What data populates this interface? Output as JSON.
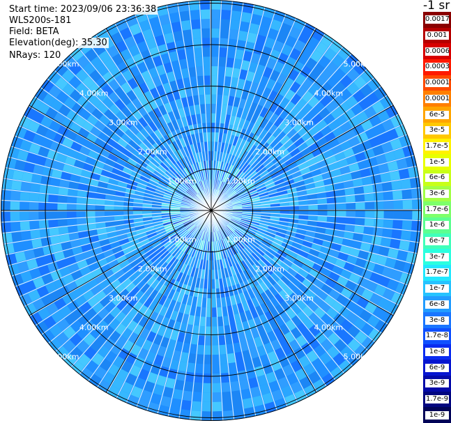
{
  "header": {
    "start_time": "Start time: 2023/09/06 23:36:38",
    "instrument": "WLS200s-181",
    "field": "Field: BETA",
    "elevation": "Elevation(deg): 35.30",
    "nrays": "NRays: 120"
  },
  "ppi": {
    "nrays": 120,
    "range_rings_km": [
      1,
      2,
      3,
      4,
      5
    ],
    "range_labels": [
      "1.00km",
      "2.00km",
      "3.00km",
      "4.00km",
      "5.00km"
    ],
    "spokes": 12,
    "dominant_color": "#1f8fff",
    "near_field_colors": [
      "#1a5fe0",
      "#3dc4ff",
      "#60e8f0"
    ]
  },
  "colorbar": {
    "title": "-1 sr",
    "levels": [
      {
        "label": "0.0017",
        "color": "#8a0000"
      },
      {
        "label": "0.001",
        "color": "#b50000"
      },
      {
        "label": "0.0006",
        "color": "#d80000"
      },
      {
        "label": "0.0003",
        "color": "#ff1a00"
      },
      {
        "label": "0.00017",
        "color": "#ff4a00"
      },
      {
        "label": "0.0001",
        "color": "#ff7f00"
      },
      {
        "label": "6e-5",
        "color": "#ffa500"
      },
      {
        "label": "3e-5",
        "color": "#ffc800"
      },
      {
        "label": "1.7e-5",
        "color": "#fff200"
      },
      {
        "label": "1e-5",
        "color": "#e8ff00"
      },
      {
        "label": "6e-6",
        "color": "#c8ff18"
      },
      {
        "label": "3e-6",
        "color": "#a2ff45"
      },
      {
        "label": "1.7e-6",
        "color": "#7dff6a"
      },
      {
        "label": "1e-6",
        "color": "#5cff90"
      },
      {
        "label": "6e-7",
        "color": "#40ffba"
      },
      {
        "label": "3e-7",
        "color": "#2bffdf"
      },
      {
        "label": "1.7e-7",
        "color": "#22e8ff"
      },
      {
        "label": "1e-7",
        "color": "#25c3ff"
      },
      {
        "label": "6e-8",
        "color": "#229cff"
      },
      {
        "label": "3e-8",
        "color": "#1a76ff"
      },
      {
        "label": "1.7e-8",
        "color": "#0f50ff"
      },
      {
        "label": "1e-8",
        "color": "#0a2cf0"
      },
      {
        "label": "6e-9",
        "color": "#0615d0"
      },
      {
        "label": "3e-9",
        "color": "#040aa8"
      },
      {
        "label": "1.7e-9",
        "color": "#020680"
      },
      {
        "label": "1e-9",
        "color": "#010358"
      }
    ]
  }
}
